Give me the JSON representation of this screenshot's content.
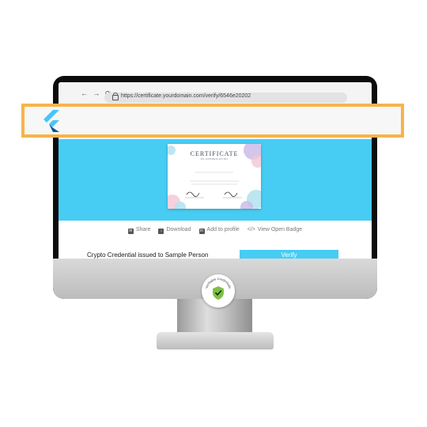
{
  "browser": {
    "nav_glyphs": "← → ⟳",
    "url": "https://certificate.yourdomain.com/verify/6546e20202"
  },
  "certificate": {
    "title": "CERTIFICATE",
    "subtitle": "OF APPRECIATION"
  },
  "actions": [
    {
      "label": "Share",
      "icon": "linkedin-icon"
    },
    {
      "label": "Download",
      "icon": "download-icon"
    },
    {
      "label": "Add to profile",
      "icon": "linkedin-icon"
    },
    {
      "label": "View Open Badge",
      "icon": "code-icon"
    }
  ],
  "credential": {
    "title": "Crypto Credential issued to Sample Person",
    "verify_label": "Verify"
  },
  "badge": {
    "text": "Verifiable Credentials",
    "icon": "shield-check-icon",
    "colors": {
      "shield": "#7cc242",
      "check": "#1f1f1f"
    }
  },
  "colors": {
    "accent": "#47ccf3",
    "highlight": "#f7b44b",
    "flutter_light": "#47c5fb",
    "flutter_dark": "#00569e"
  }
}
